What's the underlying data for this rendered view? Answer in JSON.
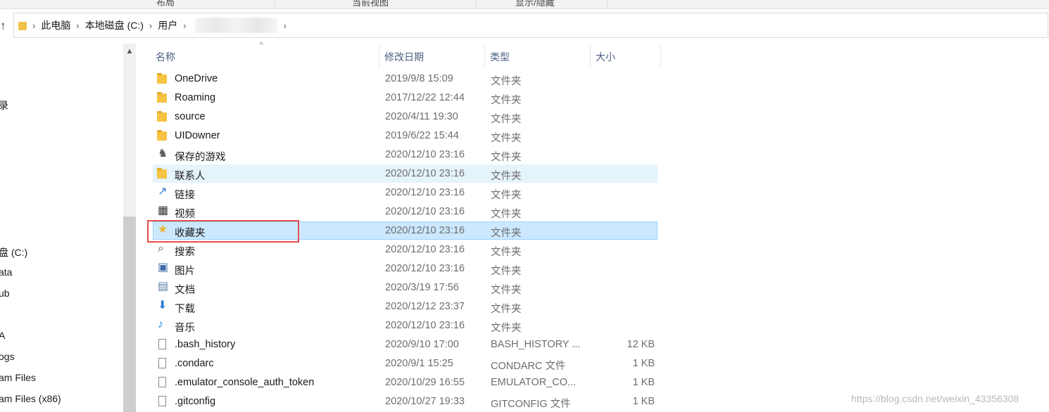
{
  "ribbon": {
    "tabs": [
      "布局",
      "当前视图",
      "显示/隐藏"
    ]
  },
  "address": {
    "crumbs": [
      "此电脑",
      "本地磁盘 (C:)",
      "用户"
    ]
  },
  "nav_pane": {
    "items": [
      "录",
      "盘 (C:)",
      "ata",
      "ub",
      "A",
      "ogs",
      "am Files",
      "am Files (x86)"
    ]
  },
  "columns": {
    "name": "名称",
    "date": "修改日期",
    "type": "类型",
    "size": "大小"
  },
  "files": [
    {
      "name": "OneDrive",
      "date": "2019/9/8 15:09",
      "type": "文件夹",
      "size": "",
      "icon": "onedrive-folder-icon"
    },
    {
      "name": "Roaming",
      "date": "2017/12/22 12:44",
      "type": "文件夹",
      "size": "",
      "icon": "folder-icon"
    },
    {
      "name": "source",
      "date": "2020/4/11 19:30",
      "type": "文件夹",
      "size": "",
      "icon": "folder-icon"
    },
    {
      "name": "UIDowner",
      "date": "2019/6/22 15:44",
      "type": "文件夹",
      "size": "",
      "icon": "folder-icon"
    },
    {
      "name": "保存的游戏",
      "date": "2020/12/10 23:16",
      "type": "文件夹",
      "size": "",
      "icon": "saved-games-icon"
    },
    {
      "name": "联系人",
      "date": "2020/12/10 23:16",
      "type": "文件夹",
      "size": "",
      "icon": "contacts-icon"
    },
    {
      "name": "链接",
      "date": "2020/12/10 23:16",
      "type": "文件夹",
      "size": "",
      "icon": "links-icon"
    },
    {
      "name": "视频",
      "date": "2020/12/10 23:16",
      "type": "文件夹",
      "size": "",
      "icon": "videos-icon"
    },
    {
      "name": "收藏夹",
      "date": "2020/12/10 23:16",
      "type": "文件夹",
      "size": "",
      "icon": "favorites-icon"
    },
    {
      "name": "搜索",
      "date": "2020/12/10 23:16",
      "type": "文件夹",
      "size": "",
      "icon": "search-icon"
    },
    {
      "name": "图片",
      "date": "2020/12/10 23:16",
      "type": "文件夹",
      "size": "",
      "icon": "pictures-icon"
    },
    {
      "name": "文档",
      "date": "2020/3/19 17:56",
      "type": "文件夹",
      "size": "",
      "icon": "documents-icon"
    },
    {
      "name": "下载",
      "date": "2020/12/12 23:37",
      "type": "文件夹",
      "size": "",
      "icon": "downloads-icon"
    },
    {
      "name": "音乐",
      "date": "2020/12/10 23:16",
      "type": "文件夹",
      "size": "",
      "icon": "music-icon"
    },
    {
      "name": ".bash_history",
      "date": "2020/9/10 17:00",
      "type": "BASH_HISTORY ...",
      "size": "12 KB",
      "icon": "file-icon"
    },
    {
      "name": ".condarc",
      "date": "2020/9/1 15:25",
      "type": "CONDARC 文件",
      "size": "1 KB",
      "icon": "file-icon"
    },
    {
      "name": ".emulator_console_auth_token",
      "date": "2020/10/29 16:55",
      "type": "EMULATOR_CO...",
      "size": "1 KB",
      "icon": "file-icon"
    },
    {
      "name": ".gitconfig",
      "date": "2020/10/27 19:33",
      "type": "GITCONFIG 文件",
      "size": "1 KB",
      "icon": "file-icon"
    }
  ],
  "hover_index": 5,
  "selected_index": 8,
  "watermark": "https://blog.csdn.net/weixin_43356308"
}
